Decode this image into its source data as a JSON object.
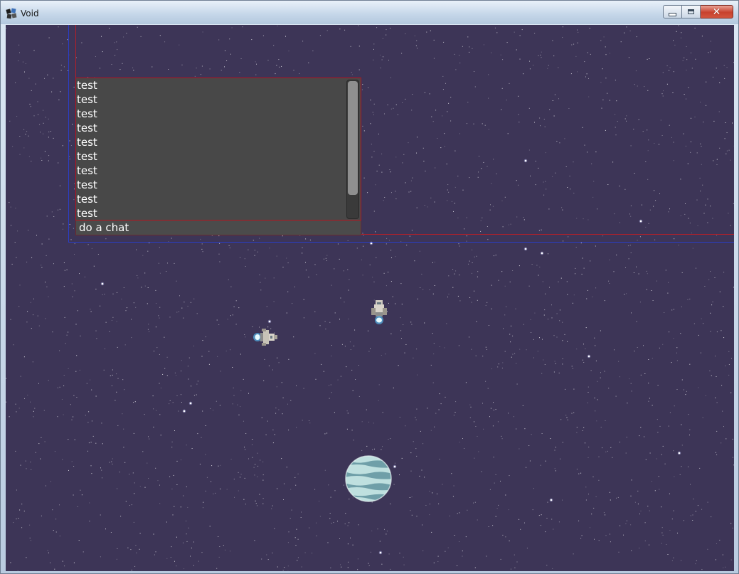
{
  "window": {
    "title": "Void",
    "icons": {
      "app": "void-app-icon",
      "minimize": "minimize-icon",
      "maximize": "maximize-icon",
      "close": "close-icon"
    }
  },
  "chat": {
    "lines": [
      "test",
      "test",
      "test",
      "test",
      "test",
      "test",
      "test",
      "test",
      "test",
      "test"
    ],
    "input_value": "do a chat"
  },
  "scene": {
    "background": "#3d3557",
    "sprites": [
      "ship-icon",
      "ship-icon",
      "planet-icon"
    ]
  },
  "colors": {
    "space": "#3d3557",
    "chat_border": "#b4141e",
    "guide_blue": "#2a3ec8",
    "planet": "#8fc0c6"
  }
}
